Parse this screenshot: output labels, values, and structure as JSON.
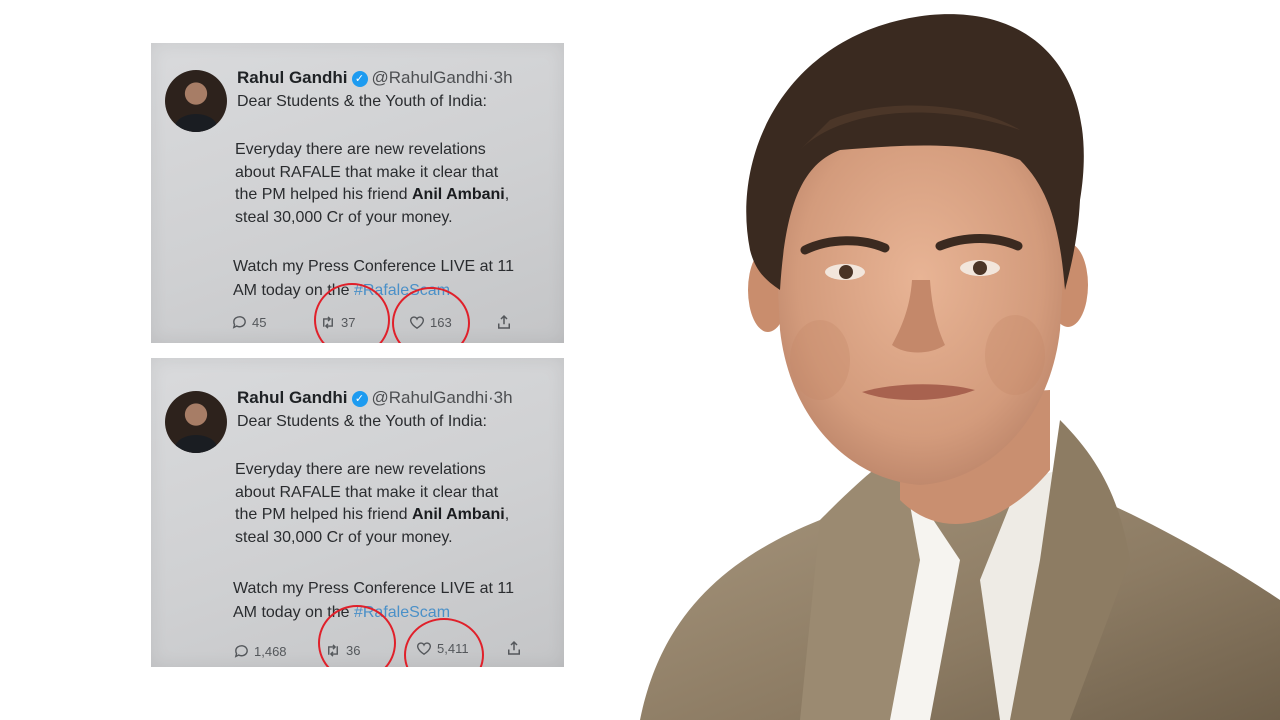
{
  "tweets": [
    {
      "name": "Rahul Gandhi",
      "handle": "@RahulGandhi",
      "time": "3h",
      "greeting": "Dear Students & the Youth of India:",
      "lines": [
        "Everyday there are new revelations",
        "about RAFALE that make it clear that",
        "the PM helped his friend ",
        "steal 30,000 Cr of your money."
      ],
      "bold_name": "Anil Ambani",
      "line3_suffix": ",",
      "cta_line1": "Watch my Press Conference LIVE at 11",
      "cta_line2": "AM today on the ",
      "hashtag": "#RafaleScam",
      "replies": "45",
      "retweets": "37",
      "likes": "163"
    },
    {
      "name": "Rahul Gandhi",
      "handle": "@RahulGandhi",
      "time": "3h",
      "greeting": "Dear Students & the Youth of India:",
      "lines": [
        "Everyday there are new revelations",
        "about RAFALE that make it clear that",
        "the PM helped his friend ",
        "steal 30,000 Cr of your money."
      ],
      "bold_name": "Anil Ambani",
      "line3_suffix": ",",
      "cta_line1": "Watch my Press Conference LIVE at 11",
      "cta_line2": "AM today on the ",
      "hashtag": "#RafaleScam",
      "replies": "1,468",
      "retweets": "36",
      "likes": "5,411"
    }
  ],
  "colors": {
    "highlight_circle": "#e0202a",
    "verified_badge": "#1d9bf0",
    "hashtag": "#4a90c8"
  },
  "icons": [
    "verified-badge-icon",
    "reply-icon",
    "retweet-icon",
    "like-icon",
    "share-icon"
  ]
}
